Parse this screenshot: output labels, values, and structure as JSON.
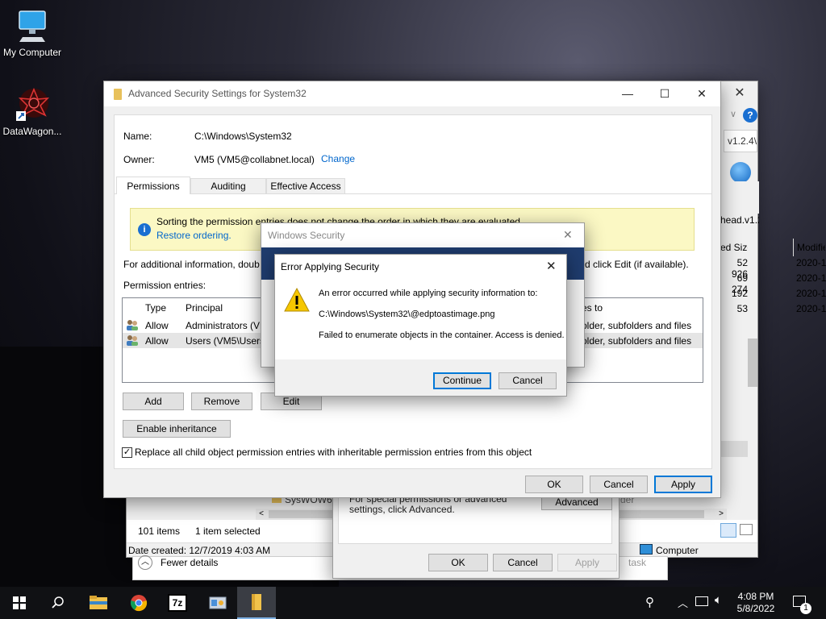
{
  "desktop": {
    "icons": [
      {
        "label": "My Computer"
      },
      {
        "label": "DataWagon..."
      }
    ]
  },
  "explorer": {
    "address": "v1.2.4\\",
    "path2": "head.v1.2.4\\",
    "columns": [
      "ed Size",
      "Modifie"
    ],
    "rows": [
      {
        "size": "52 926",
        "date": "2020-11"
      },
      {
        "size": "69 274",
        "date": "2020-11"
      },
      {
        "size": "192",
        "date": "2020-11"
      },
      {
        "size": "53",
        "date": "2020-11"
      }
    ],
    "folder_partial": "SysWOW64",
    "status_items": "101 items",
    "status_selected": "1 item selected",
    "date_created": "Date created: 12/7/2019 4:03 AM",
    "location": "Computer",
    "fewer_details": "Fewer details",
    "task_label": "task"
  },
  "properties": {
    "special_text": "For special permissions or advanced settings, click Advanced.",
    "advanced": "Advanced",
    "ok": "OK",
    "cancel": "Cancel",
    "apply": "Apply",
    "order_partial": "der"
  },
  "advanced": {
    "title": "Advanced Security Settings for System32",
    "name_label": "Name:",
    "name_value": "C:\\Windows\\System32",
    "owner_label": "Owner:",
    "owner_value": "VM5 (VM5@collabnet.local)",
    "change": "Change",
    "tabs": [
      "Permissions",
      "Auditing",
      "Effective Access"
    ],
    "info_text": "Sorting the permission entries does not change the order in which they are evaluated.",
    "restore": "Restore ordering.",
    "additional": "For additional information, doub",
    "additional_right": "d click Edit (if available).",
    "entries_label": "Permission entries:",
    "col_type": "Type",
    "col_principal": "Principal",
    "col_applies": "es to",
    "entries": [
      {
        "type": "Allow",
        "principal": "Administrators (VM",
        "applies": "older, subfolders and files"
      },
      {
        "type": "Allow",
        "principal": "Users (VM5\\Users)",
        "applies": "older, subfolders and files"
      }
    ],
    "add": "Add",
    "remove": "Remove",
    "edit": "Edit",
    "enable_inheritance": "Enable inheritance",
    "replace_label": "Replace all child object permission entries with inheritable permission entries from this object",
    "replace_checked": true,
    "ok": "OK",
    "cancel": "Cancel",
    "apply": "Apply"
  },
  "winsec": {
    "title": "Windows Security"
  },
  "error": {
    "title": "Error Applying Security",
    "line1": "An error occurred while applying security information to:",
    "path": "C:\\Windows\\System32\\@edptoastimage.png",
    "line2": "Failed to enumerate objects in the container. Access is denied.",
    "continue": "Continue",
    "cancel": "Cancel"
  },
  "taskbar": {
    "time": "4:08 PM",
    "date": "5/8/2022",
    "notif_count": "1"
  }
}
